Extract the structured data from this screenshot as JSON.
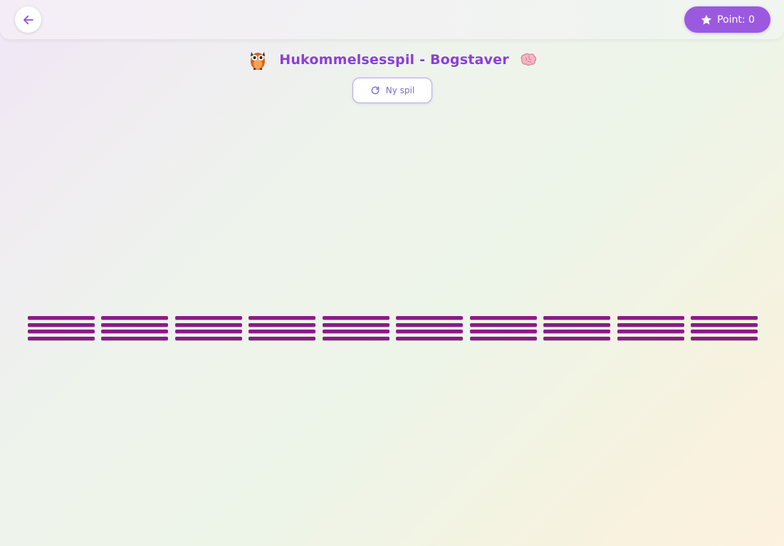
{
  "header": {
    "back_icon": "arrow-left-icon",
    "points_icon": "star-icon",
    "points_label": "Point: 0",
    "accent": "#9b59e0"
  },
  "title": {
    "left_icon": "owl-icon",
    "text": "Hukommelsesspil - Bogstaver",
    "right_icon": "brain-icon",
    "color": "#8a3fd6"
  },
  "controls": {
    "new_game_icon": "refresh-icon",
    "new_game_label": "Ny spil"
  },
  "board": {
    "card_back_color": "#8b1a86",
    "cards": [
      {
        "state": "face-down"
      },
      {
        "state": "face-down"
      },
      {
        "state": "face-down"
      },
      {
        "state": "face-down"
      },
      {
        "state": "face-down"
      },
      {
        "state": "face-down"
      },
      {
        "state": "face-down"
      },
      {
        "state": "face-down"
      },
      {
        "state": "face-down"
      },
      {
        "state": "face-down"
      }
    ]
  }
}
